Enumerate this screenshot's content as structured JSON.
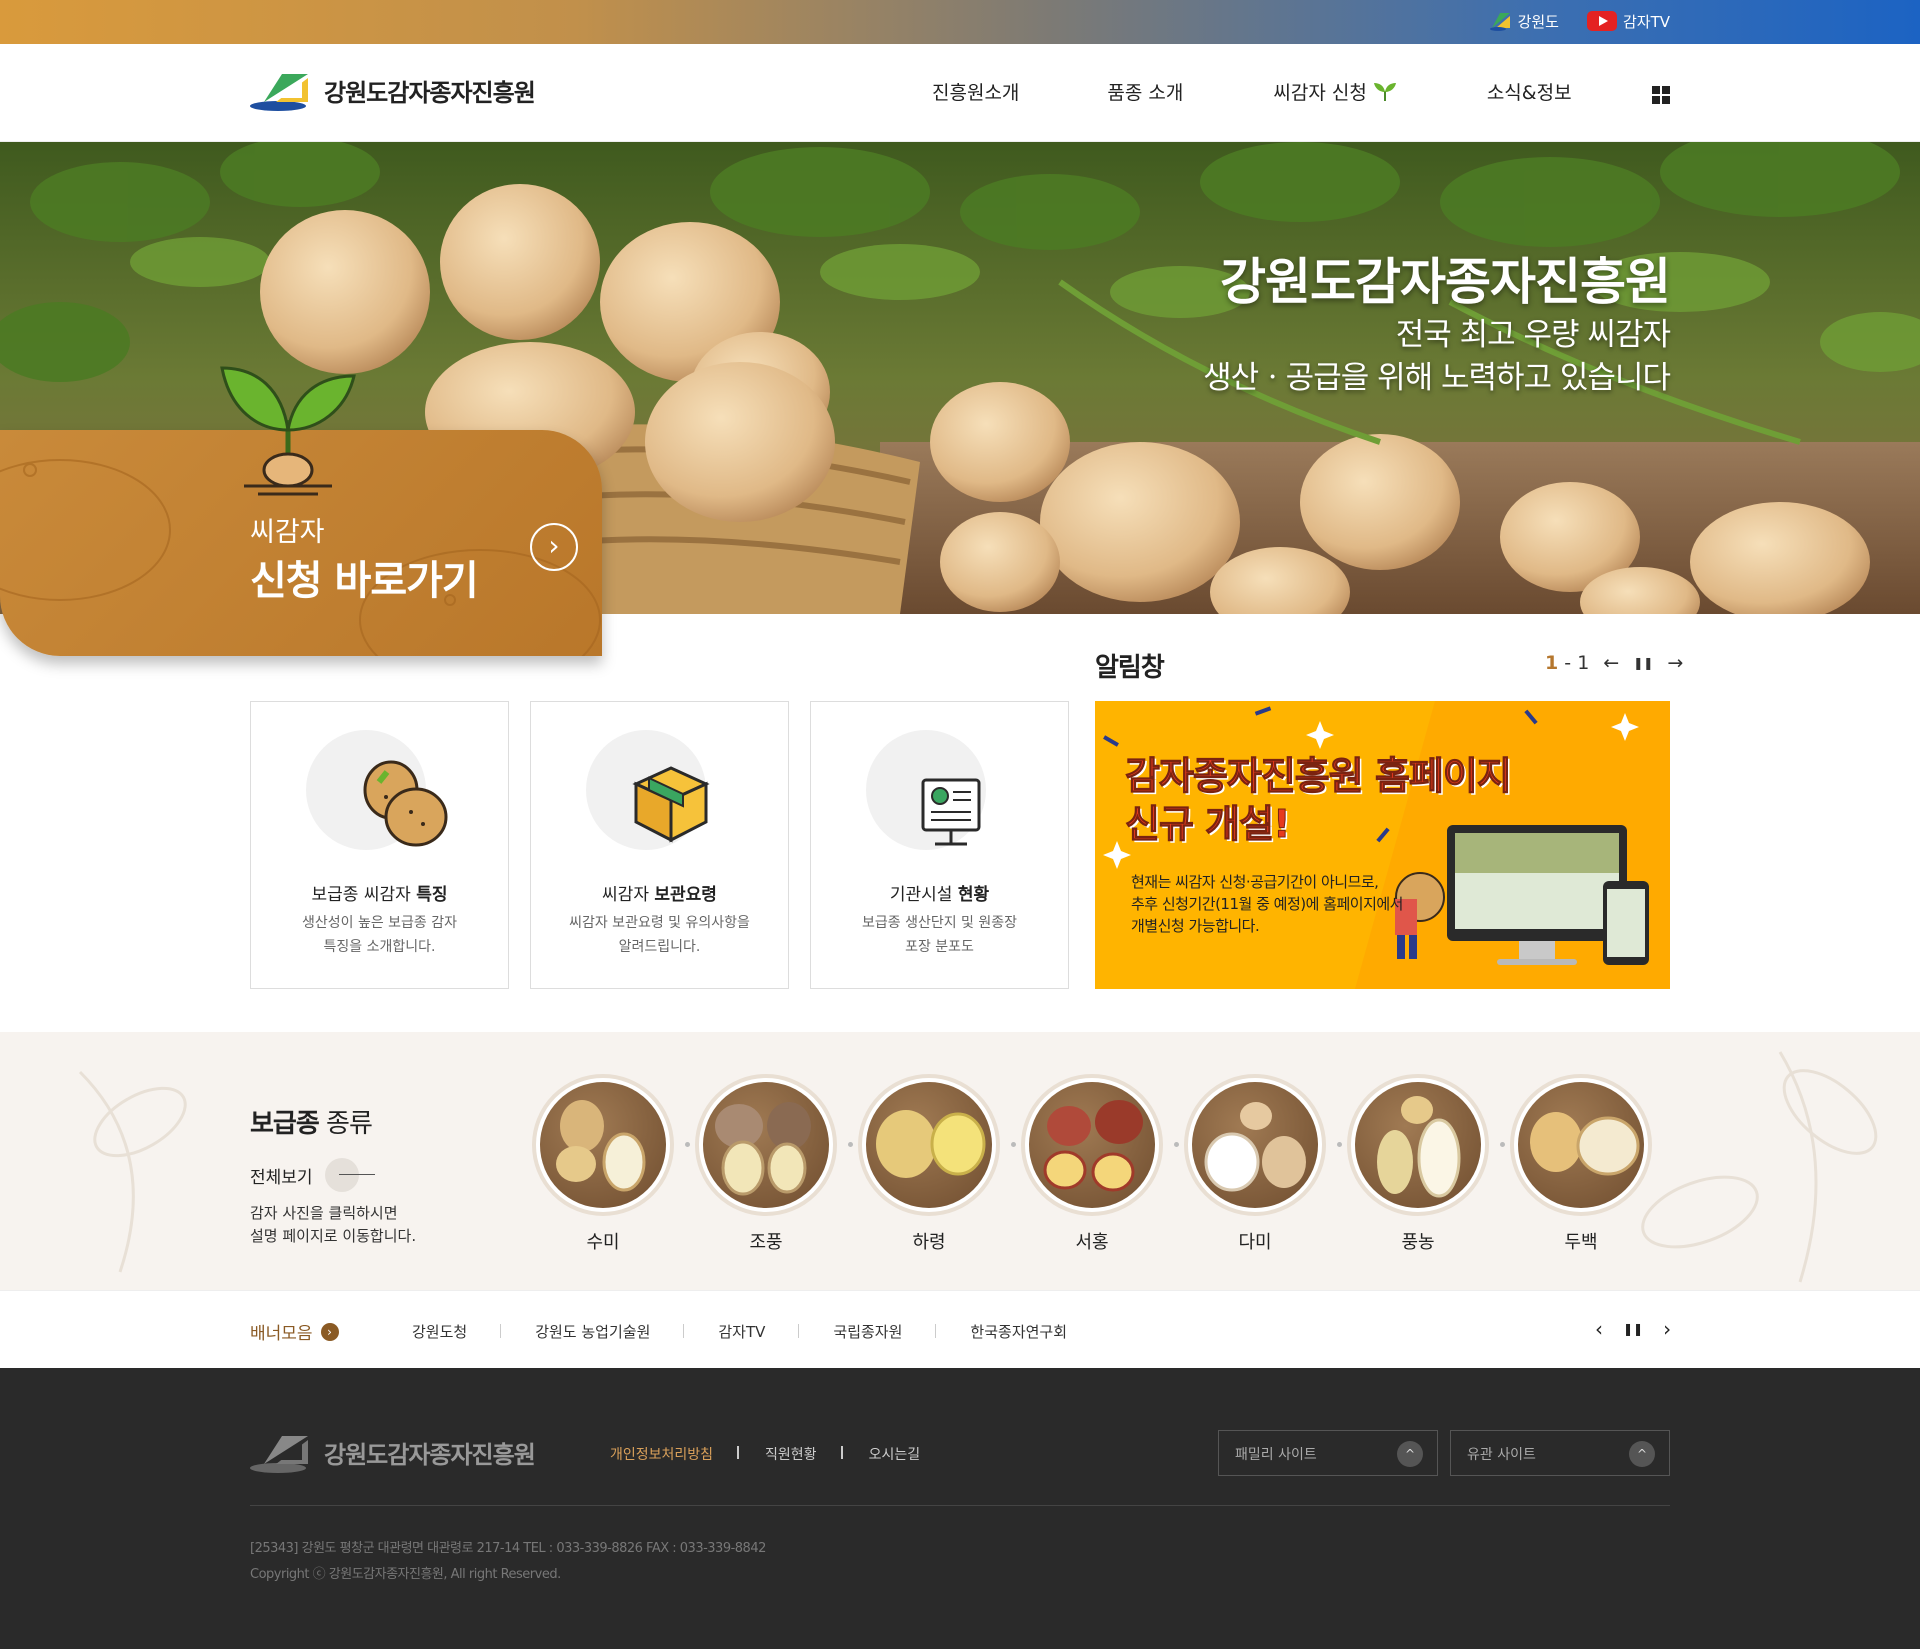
{
  "topbar": {
    "links": [
      {
        "label": "강원도",
        "icon": "gangwon-logo-icon"
      },
      {
        "label": "감자TV",
        "icon": "youtube-icon"
      }
    ]
  },
  "header": {
    "logo_text": "강원도감자종자진흥원",
    "menu": [
      "진흥원소개",
      "품종 소개",
      "씨감자 신청",
      "소식&정보"
    ],
    "allmenu_icon": "grid-menu-icon"
  },
  "hero": {
    "title": "강원도감자종자진흥원",
    "subtitle_line1": "전국 최고 우량 씨감자",
    "subtitle_line2": "생산ㆍ공급을 위해 노력하고 있습니다"
  },
  "apply": {
    "line1": "씨감자",
    "line2": "신청 바로가기",
    "arrow": "›"
  },
  "cards": [
    {
      "title_normal": "보급종 씨감자 ",
      "title_bold": "특징",
      "desc1": "생산성이 높은 보급종 감자",
      "desc2": "특징을 소개합니다.",
      "icon": "potato-icon"
    },
    {
      "title_normal": "씨감자 ",
      "title_bold": "보관요령",
      "desc1": "씨감자 보관요령 및 유의사항을",
      "desc2": "알려드립니다.",
      "icon": "box-icon"
    },
    {
      "title_normal": "기관시설 ",
      "title_bold": "현황",
      "desc1": "보급종 생산단지 및 원종장",
      "desc2": "포장 분포도",
      "icon": "monitor-chart-icon"
    }
  ],
  "notice": {
    "title": "알림창",
    "current": "1",
    "separator": "-",
    "total": "1",
    "prev": "←",
    "pause": "❚❚",
    "next": "→",
    "popup_title1": "감자종자진흥원 홈페이지",
    "popup_title2": "신규 개설!",
    "popup_desc1": "현재는 씨감자 신청·공급기간이 아니므로,",
    "popup_desc2": "추후 신청기간(11월 중 예정)에 홈페이지에서",
    "popup_desc3": "개별신청 가능합니다."
  },
  "varieties": {
    "title_bold": "보급종",
    "title_normal": " 종류",
    "view_all": "전체보기",
    "desc1": "감자 사진을 클릭하시면",
    "desc2": "설명 페이지로 이동합니다.",
    "items": [
      "수미",
      "조풍",
      "하령",
      "서홍",
      "다미",
      "풍농",
      "두백"
    ]
  },
  "banners": {
    "title": "배너모음",
    "links": [
      "강원도청",
      "강원도 농업기술원",
      "감자TV",
      "국립종자원",
      "한국종자연구회"
    ],
    "prev": "‹",
    "pause": "❚❚",
    "next": "›"
  },
  "footer": {
    "logo_text": "강원도감자종자진흥원",
    "links": [
      "개인정보처리방침",
      "직원현황",
      "오시는길"
    ],
    "family_site": "패밀리 사이트",
    "related_site": "유관 사이트",
    "chevron": "^",
    "address": "[25343] 강원도 평창군 대관령면 대관령로 217-14    TEL : 033-339-8826    FAX : 033-339-8842",
    "copyright": "Copyright ⓒ 강원도감자종자진흥원, All right Reserved."
  }
}
